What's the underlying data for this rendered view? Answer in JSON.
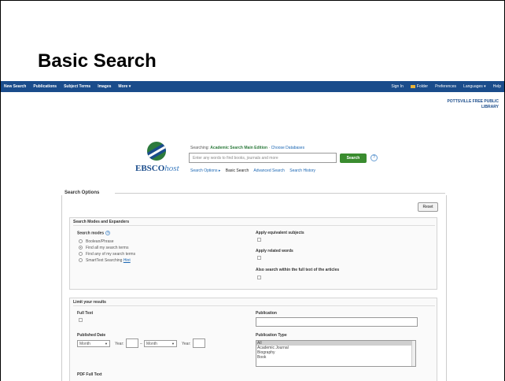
{
  "slide_title": "Basic Search",
  "nav": {
    "left": [
      "New Search",
      "Publications",
      "Subject Terms",
      "Images",
      "More ▾"
    ],
    "right": [
      "Sign In",
      "Folder",
      "Preferences",
      "Languages ▾",
      "Help"
    ]
  },
  "library_name": "POTTSVILLE FREE PUBLIC LIBRARY",
  "logo": {
    "brand": "EBSCO",
    "host": "host"
  },
  "search": {
    "searching_label": "Searching:",
    "database": "Academic Search Main Edition",
    "choose_db": "Choose Databases",
    "placeholder": "Enter any words to find books, journals and more",
    "button": "Search",
    "help": "?",
    "links": {
      "options": "Search Options ▸",
      "basic": "Basic Search",
      "advanced": "Advanced Search",
      "history": "Search History"
    }
  },
  "options": {
    "title": "Search Options",
    "reset": "Reset",
    "modes_section": {
      "title": "Search Modes and Expanders",
      "modes_label": "Search modes",
      "help": "?",
      "modes": [
        "Boolean/Phrase",
        "Find all my search terms",
        "Find any of my search terms",
        "SmartText Searching"
      ],
      "selected_mode": "Find all my search terms",
      "hint": "Hint",
      "expanders": [
        "Apply equivalent subjects",
        "Apply related words",
        "Also search within the full text of the articles"
      ]
    },
    "limit_section": {
      "title": "Limit your results",
      "full_text": "Full Text",
      "published_date": "Published Date",
      "month": "Month",
      "year_label": "Year:",
      "dash": "–",
      "publication": "Publication",
      "publication_type": "Publication Type",
      "pub_types": [
        "All",
        "Academic Journal",
        "Biography",
        "Book"
      ],
      "pdf_full_text": "PDF Full Text"
    }
  }
}
